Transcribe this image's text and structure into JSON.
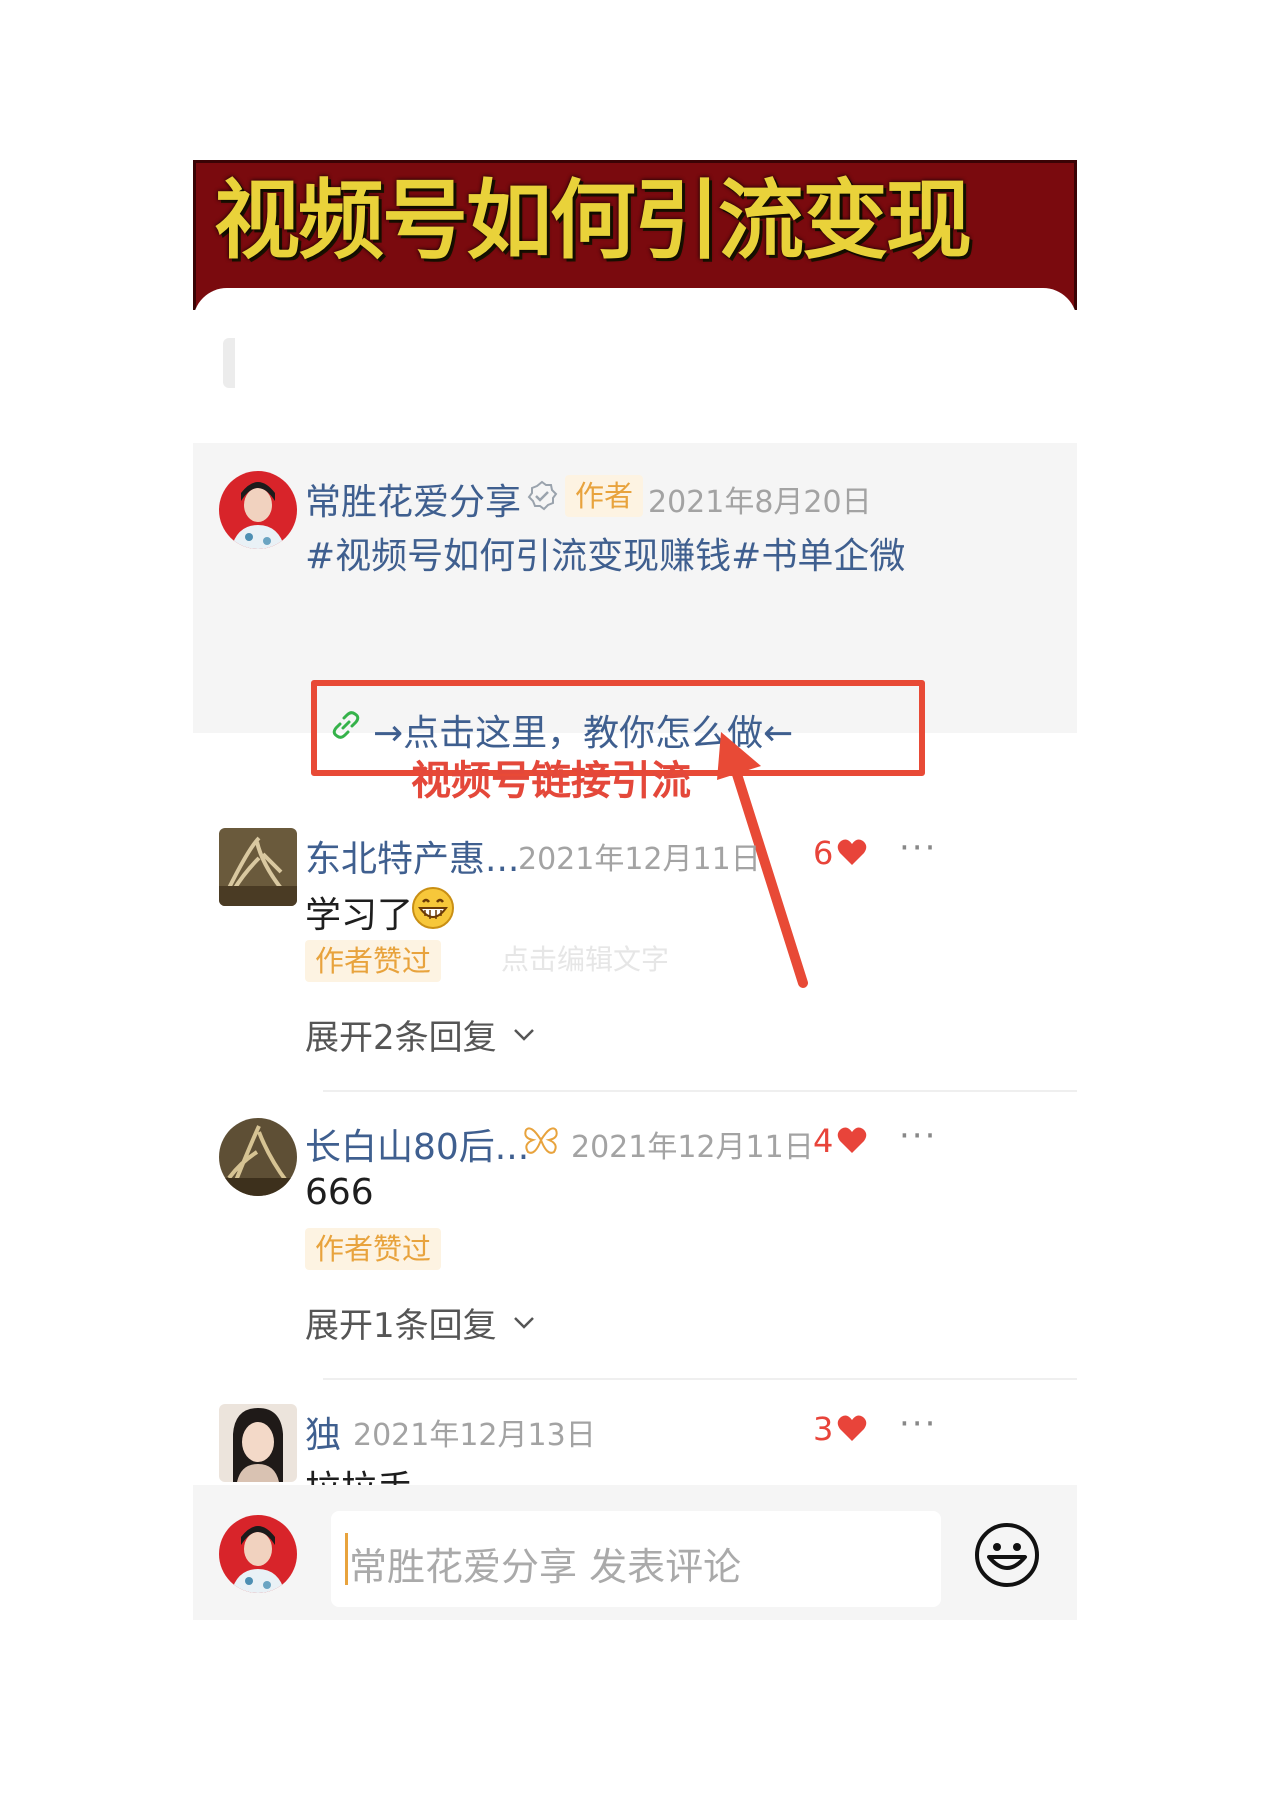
{
  "banner": {
    "title": "视频号如何引流变现"
  },
  "pinned_comment": {
    "author": "常胜花爱分享",
    "author_tag": "作者",
    "date": "2021年8月20日",
    "text": "#视频号如何引流变现赚钱#书单企微",
    "link_text": "→点击这里，教你怎么做←"
  },
  "annotation": "视频号链接引流",
  "comments": [
    {
      "author": "东北特产惠...",
      "date": "2021年12月11日",
      "likes": "6",
      "text": "学习了",
      "badge": "作者赞过",
      "expand": "展开2条回复",
      "faint_overlay": "点击编辑文字"
    },
    {
      "author": "长白山80后...",
      "date": "2021年12月11日",
      "likes": "4",
      "text": "666",
      "badge": "作者赞过",
      "expand": "展开1条回复"
    },
    {
      "author": "独",
      "date": "2021年12月13日",
      "likes": "3",
      "text": "拉拉手"
    }
  ],
  "composer": {
    "placeholder": "常胜花爱分享 发表评论"
  },
  "more_label": "···",
  "colors": {
    "accent": "#e8443a",
    "name_blue": "#3f5f8f",
    "tag_orange": "#e8a33d",
    "annotation_red": "#e4483a"
  },
  "icons": [
    "verified-badge-icon",
    "link-icon",
    "heart-icon",
    "more-icon",
    "chevron-down-icon",
    "emoji-icon",
    "butterfly-badge-icon",
    "grin-emoji-icon"
  ]
}
